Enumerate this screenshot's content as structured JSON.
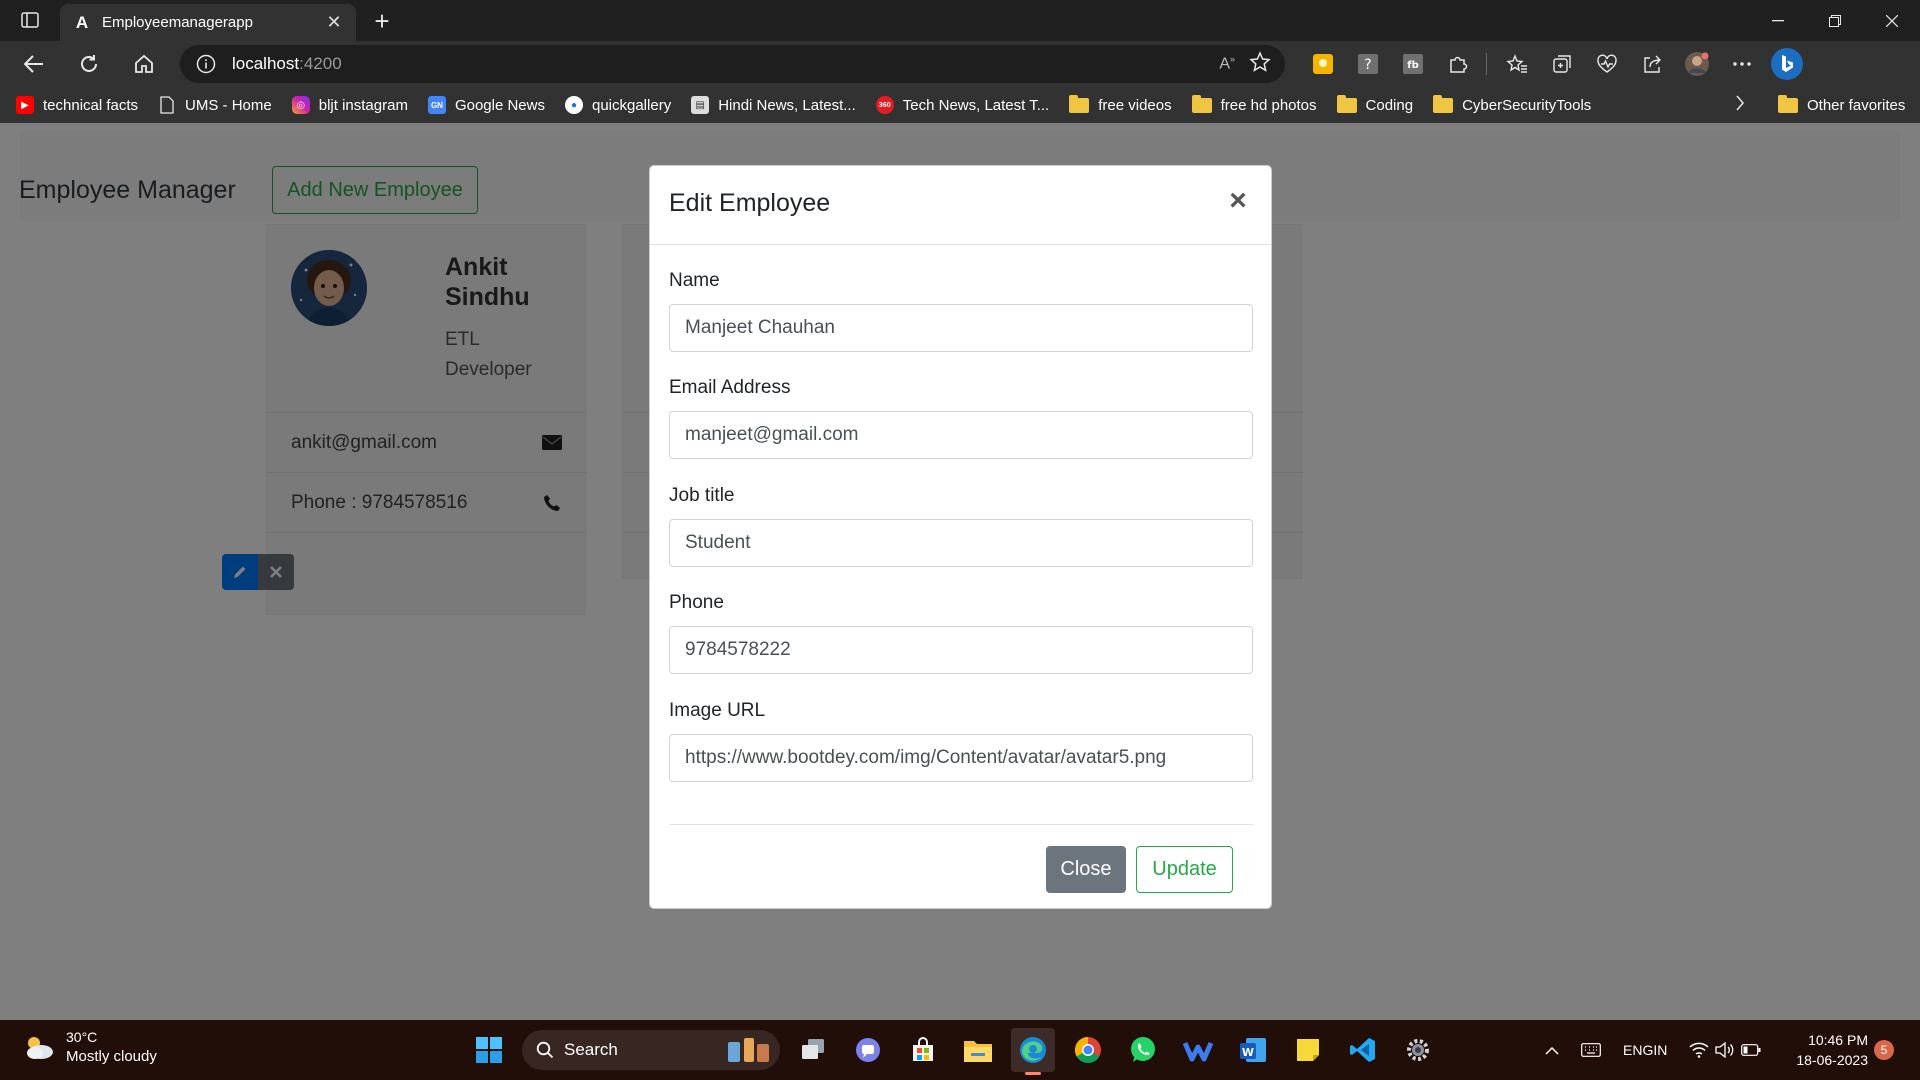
{
  "browser": {
    "tab": {
      "title": "Employeemanagerapp",
      "favicon": "A"
    },
    "address": {
      "host": "localhost",
      "port": ":4200"
    },
    "favorites": [
      {
        "label": "technical facts",
        "icon": "youtube-icon",
        "color": "#ff0000"
      },
      {
        "label": "UMS - Home",
        "icon": "page-icon",
        "color": "#323232"
      },
      {
        "label": "bljt instagram",
        "icon": "instagram-icon",
        "color": "#d6249f"
      },
      {
        "label": "Google News",
        "icon": "google-news-icon",
        "color": "#4285f4"
      },
      {
        "label": "quickgallery",
        "icon": "quickgallery-icon",
        "color": "#1a73e8"
      },
      {
        "label": "Hindi News, Latest...",
        "icon": "news-icon",
        "color": "#888888"
      },
      {
        "label": "Tech News, Latest T...",
        "icon": "tech360-icon",
        "color": "#e51c23"
      },
      {
        "label": "free videos",
        "icon": "folder-icon"
      },
      {
        "label": "free hd photos",
        "icon": "folder-icon"
      },
      {
        "label": "Coding",
        "icon": "folder-icon"
      },
      {
        "label": "CyberSecurityTools",
        "icon": "folder-icon"
      }
    ],
    "other_favorites": "Other favorites"
  },
  "page": {
    "brand": "Employee Manager",
    "add_button": "Add New Employee",
    "card": {
      "name": "Ankit Sindhu",
      "job": "ETL Developer",
      "email": "ankit@gmail.com",
      "phone": "Phone : 9784578516"
    }
  },
  "modal": {
    "title": "Edit Employee",
    "fields": {
      "name": {
        "label": "Name",
        "value": "Manjeet Chauhan"
      },
      "email": {
        "label": "Email Address",
        "value": "manjeet@gmail.com"
      },
      "job": {
        "label": "Job title",
        "value": "Student"
      },
      "phone": {
        "label": "Phone",
        "value": "9784578222"
      },
      "image": {
        "label": "Image URL",
        "value": "https://www.bootdey.com/img/Content/avatar/avatar5.png"
      }
    },
    "close_label": "Close",
    "update_label": "Update"
  },
  "taskbar": {
    "weather": {
      "temp": "30°C",
      "condition": "Mostly cloudy"
    },
    "search_label": "Search",
    "lang": {
      "line1": "ENG",
      "line2": "IN"
    },
    "time": "10:46 PM",
    "date": "18-06-2023",
    "notification_count": "5"
  },
  "colors": {
    "primary": "#007bff",
    "success": "#28a745",
    "secondary": "#6c757d"
  }
}
